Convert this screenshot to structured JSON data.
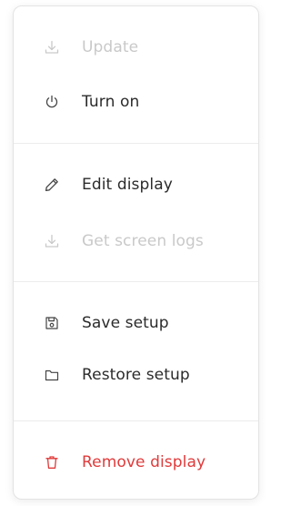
{
  "menu": {
    "items": [
      {
        "label": "Update",
        "icon": "download-icon",
        "state": "disabled"
      },
      {
        "label": "Turn on",
        "icon": "power-icon",
        "state": "enabled"
      },
      {
        "label": "Edit display",
        "icon": "pencil-icon",
        "state": "enabled"
      },
      {
        "label": "Get screen logs",
        "icon": "download-icon",
        "state": "disabled"
      },
      {
        "label": "Save setup",
        "icon": "save-icon",
        "state": "enabled"
      },
      {
        "label": "Restore setup",
        "icon": "folder-icon",
        "state": "enabled"
      },
      {
        "label": "Remove display",
        "icon": "trash-icon",
        "state": "danger"
      }
    ]
  },
  "colors": {
    "disabled": "#c9c9c9",
    "text": "#2b2b2b",
    "danger": "#e03a3a",
    "divider": "#ececec"
  }
}
